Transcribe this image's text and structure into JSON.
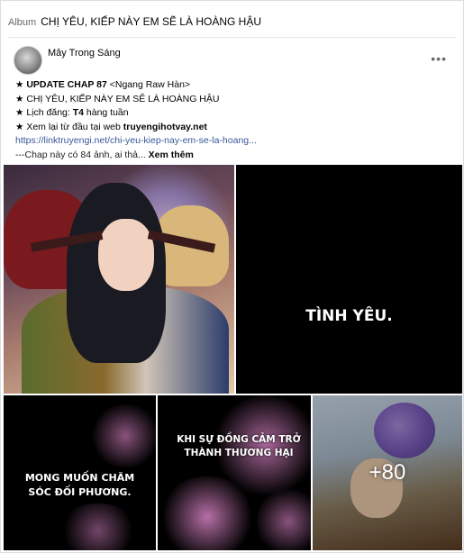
{
  "album": {
    "prefix": "Album",
    "title": "CHỊ YÊU, KIẾP NÀY EM SẼ LÀ HOÀNG HẬU"
  },
  "post": {
    "author": "Mây Trong Sáng",
    "more_label": "•••",
    "lines": {
      "l1_star": "★ ",
      "l1_bold": "UPDATE CHAP 87",
      "l1_rest": " <Ngang Raw Hàn>",
      "l2": "★ CHỊ YÊU, KIẾP NÀY EM SẼ LÀ HOÀNG HẬU",
      "l3_pre": "★ Lịch đăng: ",
      "l3_bold": "T4",
      "l3_rest": " hàng tuần",
      "l4_pre": "★ Xem lại từ đầu tại web ",
      "l4_bold": "truyengihotvay.net",
      "link": "https://linktruyengi.net/chi-yeu-kiep-nay-em-se-la-hoang...",
      "l6": "---Chap này có 84 ảnh, ai thả... ",
      "see_more": "Xem thêm"
    }
  },
  "photos": {
    "t2_caption": "TÌNH YÊU.",
    "t3_caption": "MONG MUỐN CHĂM SÓC ĐỐI PHƯƠNG.",
    "t4_caption": "KHI SỰ ĐỒNG CẢM TRỞ THÀNH THƯƠNG HẠI",
    "more_count": "+80"
  },
  "colors": {
    "link": "#385898",
    "glow_pink": "#e48bd0"
  }
}
